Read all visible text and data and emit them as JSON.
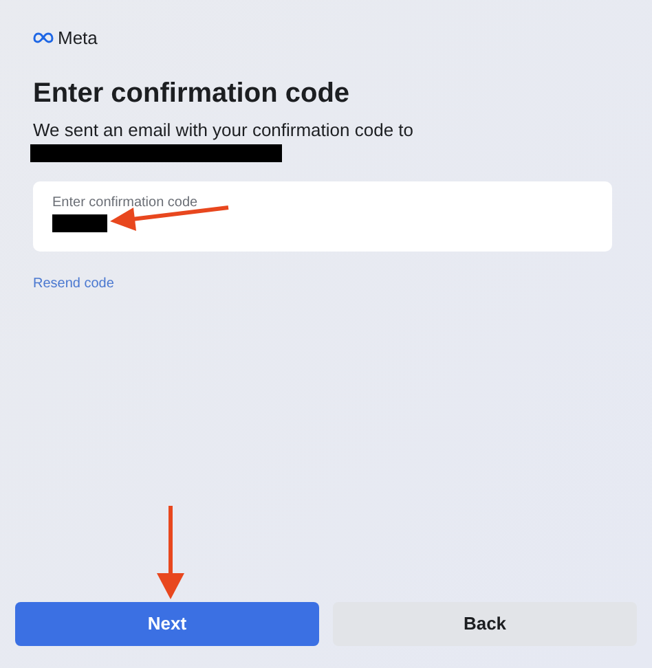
{
  "brand": {
    "name": "Meta"
  },
  "title": "Enter confirmation code",
  "message": "We sent an email with your confirmation code to",
  "email_redacted": true,
  "code_field": {
    "label": "Enter confirmation code",
    "value_redacted": true
  },
  "resend_link": "Resend code",
  "buttons": [
    {
      "label": "Next",
      "kind": "primary"
    },
    {
      "label": "Back",
      "kind": "secondary"
    }
  ],
  "annotations": [
    {
      "kind": "arrow-left"
    },
    {
      "kind": "arrow-down"
    }
  ]
}
